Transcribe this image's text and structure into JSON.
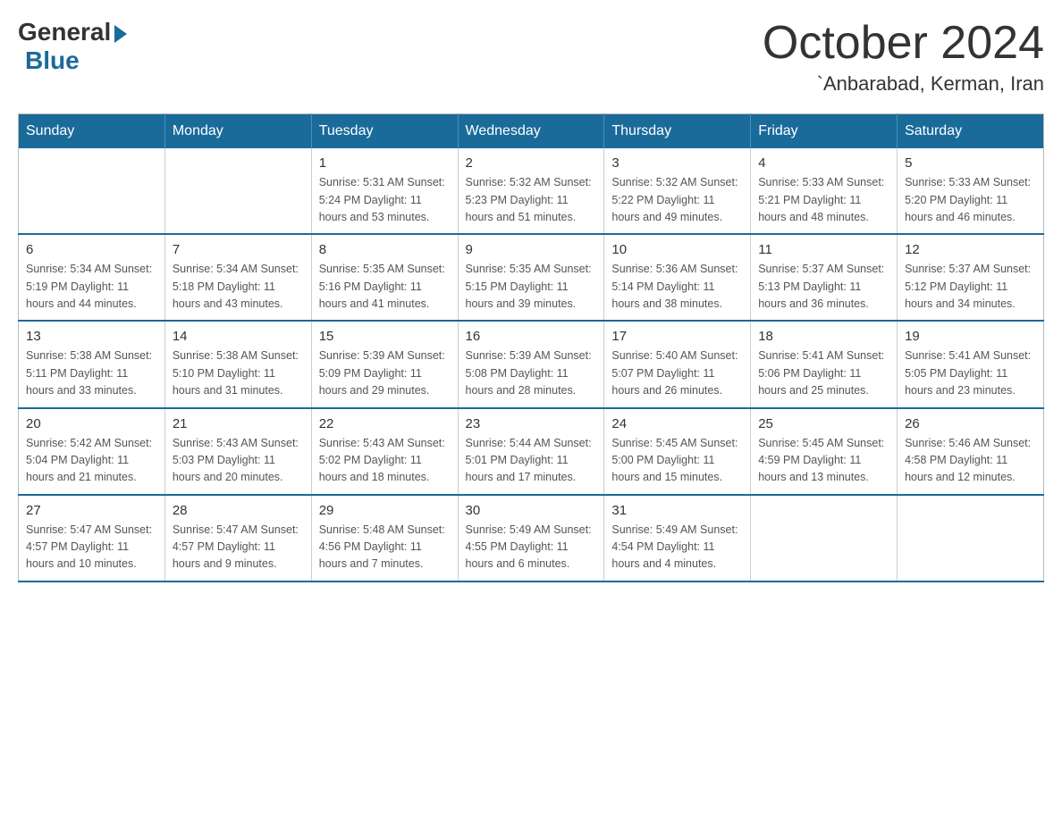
{
  "header": {
    "logo_general": "General",
    "logo_blue": "Blue",
    "month_title": "October 2024",
    "location": "`Anbarabad, Kerman, Iran"
  },
  "calendar": {
    "days_of_week": [
      "Sunday",
      "Monday",
      "Tuesday",
      "Wednesday",
      "Thursday",
      "Friday",
      "Saturday"
    ],
    "weeks": [
      [
        {
          "day": "",
          "info": ""
        },
        {
          "day": "",
          "info": ""
        },
        {
          "day": "1",
          "info": "Sunrise: 5:31 AM\nSunset: 5:24 PM\nDaylight: 11 hours\nand 53 minutes."
        },
        {
          "day": "2",
          "info": "Sunrise: 5:32 AM\nSunset: 5:23 PM\nDaylight: 11 hours\nand 51 minutes."
        },
        {
          "day": "3",
          "info": "Sunrise: 5:32 AM\nSunset: 5:22 PM\nDaylight: 11 hours\nand 49 minutes."
        },
        {
          "day": "4",
          "info": "Sunrise: 5:33 AM\nSunset: 5:21 PM\nDaylight: 11 hours\nand 48 minutes."
        },
        {
          "day": "5",
          "info": "Sunrise: 5:33 AM\nSunset: 5:20 PM\nDaylight: 11 hours\nand 46 minutes."
        }
      ],
      [
        {
          "day": "6",
          "info": "Sunrise: 5:34 AM\nSunset: 5:19 PM\nDaylight: 11 hours\nand 44 minutes."
        },
        {
          "day": "7",
          "info": "Sunrise: 5:34 AM\nSunset: 5:18 PM\nDaylight: 11 hours\nand 43 minutes."
        },
        {
          "day": "8",
          "info": "Sunrise: 5:35 AM\nSunset: 5:16 PM\nDaylight: 11 hours\nand 41 minutes."
        },
        {
          "day": "9",
          "info": "Sunrise: 5:35 AM\nSunset: 5:15 PM\nDaylight: 11 hours\nand 39 minutes."
        },
        {
          "day": "10",
          "info": "Sunrise: 5:36 AM\nSunset: 5:14 PM\nDaylight: 11 hours\nand 38 minutes."
        },
        {
          "day": "11",
          "info": "Sunrise: 5:37 AM\nSunset: 5:13 PM\nDaylight: 11 hours\nand 36 minutes."
        },
        {
          "day": "12",
          "info": "Sunrise: 5:37 AM\nSunset: 5:12 PM\nDaylight: 11 hours\nand 34 minutes."
        }
      ],
      [
        {
          "day": "13",
          "info": "Sunrise: 5:38 AM\nSunset: 5:11 PM\nDaylight: 11 hours\nand 33 minutes."
        },
        {
          "day": "14",
          "info": "Sunrise: 5:38 AM\nSunset: 5:10 PM\nDaylight: 11 hours\nand 31 minutes."
        },
        {
          "day": "15",
          "info": "Sunrise: 5:39 AM\nSunset: 5:09 PM\nDaylight: 11 hours\nand 29 minutes."
        },
        {
          "day": "16",
          "info": "Sunrise: 5:39 AM\nSunset: 5:08 PM\nDaylight: 11 hours\nand 28 minutes."
        },
        {
          "day": "17",
          "info": "Sunrise: 5:40 AM\nSunset: 5:07 PM\nDaylight: 11 hours\nand 26 minutes."
        },
        {
          "day": "18",
          "info": "Sunrise: 5:41 AM\nSunset: 5:06 PM\nDaylight: 11 hours\nand 25 minutes."
        },
        {
          "day": "19",
          "info": "Sunrise: 5:41 AM\nSunset: 5:05 PM\nDaylight: 11 hours\nand 23 minutes."
        }
      ],
      [
        {
          "day": "20",
          "info": "Sunrise: 5:42 AM\nSunset: 5:04 PM\nDaylight: 11 hours\nand 21 minutes."
        },
        {
          "day": "21",
          "info": "Sunrise: 5:43 AM\nSunset: 5:03 PM\nDaylight: 11 hours\nand 20 minutes."
        },
        {
          "day": "22",
          "info": "Sunrise: 5:43 AM\nSunset: 5:02 PM\nDaylight: 11 hours\nand 18 minutes."
        },
        {
          "day": "23",
          "info": "Sunrise: 5:44 AM\nSunset: 5:01 PM\nDaylight: 11 hours\nand 17 minutes."
        },
        {
          "day": "24",
          "info": "Sunrise: 5:45 AM\nSunset: 5:00 PM\nDaylight: 11 hours\nand 15 minutes."
        },
        {
          "day": "25",
          "info": "Sunrise: 5:45 AM\nSunset: 4:59 PM\nDaylight: 11 hours\nand 13 minutes."
        },
        {
          "day": "26",
          "info": "Sunrise: 5:46 AM\nSunset: 4:58 PM\nDaylight: 11 hours\nand 12 minutes."
        }
      ],
      [
        {
          "day": "27",
          "info": "Sunrise: 5:47 AM\nSunset: 4:57 PM\nDaylight: 11 hours\nand 10 minutes."
        },
        {
          "day": "28",
          "info": "Sunrise: 5:47 AM\nSunset: 4:57 PM\nDaylight: 11 hours\nand 9 minutes."
        },
        {
          "day": "29",
          "info": "Sunrise: 5:48 AM\nSunset: 4:56 PM\nDaylight: 11 hours\nand 7 minutes."
        },
        {
          "day": "30",
          "info": "Sunrise: 5:49 AM\nSunset: 4:55 PM\nDaylight: 11 hours\nand 6 minutes."
        },
        {
          "day": "31",
          "info": "Sunrise: 5:49 AM\nSunset: 4:54 PM\nDaylight: 11 hours\nand 4 minutes."
        },
        {
          "day": "",
          "info": ""
        },
        {
          "day": "",
          "info": ""
        }
      ]
    ]
  }
}
